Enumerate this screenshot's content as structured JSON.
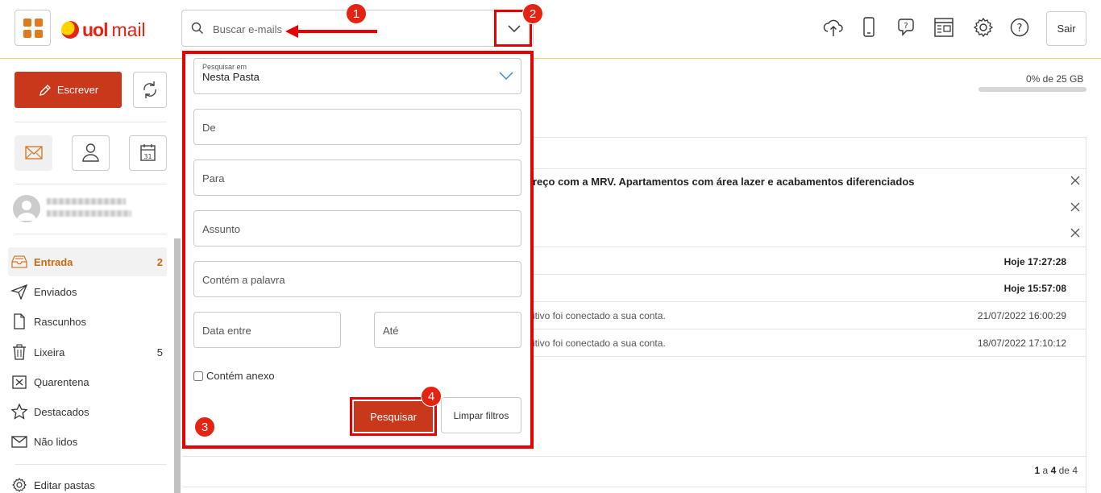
{
  "header": {
    "brand_uol": "uol",
    "brand_mail": "mail",
    "search_placeholder": "Buscar e-mails",
    "logout_label": "Sair",
    "icons": [
      "cloud-upload-icon",
      "mobile-icon",
      "help-chat-icon",
      "layout-icon",
      "gear-icon",
      "help-icon"
    ]
  },
  "annotations": {
    "badge_1": "1",
    "badge_2": "2",
    "badge_3": "3",
    "badge_4": "4",
    "color": "#e60000"
  },
  "sidebar": {
    "compose_label": "Escrever",
    "folders": [
      {
        "label": "Entrada",
        "count": "2",
        "icon": "inbox-icon"
      },
      {
        "label": "Enviados",
        "count": "",
        "icon": "send-icon"
      },
      {
        "label": "Rascunhos",
        "count": "",
        "icon": "draft-icon"
      },
      {
        "label": "Lixeira",
        "count": "5",
        "icon": "trash-icon"
      },
      {
        "label": "Quarentena",
        "count": "",
        "icon": "quarantine-icon"
      },
      {
        "label": "Destacados",
        "count": "",
        "icon": "star-icon"
      },
      {
        "label": "Não lidos",
        "count": "",
        "icon": "envelope-icon"
      },
      {
        "label": "Editar pastas",
        "count": "",
        "icon": "gear-icon"
      }
    ]
  },
  "storage": {
    "label": "0% de 25 GB",
    "used_fraction": 0.0
  },
  "messages": [
    {
      "text": "reço com a MRV. Apartamentos com área lazer e acabamentos diferenciados",
      "date": "",
      "bold": true
    },
    {
      "text": "",
      "date": "Hoje 17:27:28",
      "bold": true
    },
    {
      "text": "",
      "date": "Hoje 15:57:08",
      "bold": true
    },
    {
      "text": "itivo foi conectado a sua conta.",
      "date": "21/07/2022 16:00:29",
      "bold": false
    },
    {
      "text": "itivo foi conectado a sua conta.",
      "date": "18/07/2022 17:10:12",
      "bold": false
    }
  ],
  "pager": {
    "from": "1",
    "sep1": "a",
    "to": "4",
    "sep2": "de",
    "total": "4"
  },
  "advanced_search": {
    "search_in_label": "Pesquisar em",
    "search_in_value": "Nesta Pasta",
    "from_placeholder": "De",
    "to_placeholder": "Para",
    "subject_placeholder": "Assunto",
    "contains_placeholder": "Contém a palavra",
    "date_from_placeholder": "Data entre",
    "date_to_placeholder": "Até",
    "attachment_label": "Contém anexo",
    "search_button": "Pesquisar",
    "clear_button": "Limpar filtros"
  },
  "colors": {
    "accent": "#c9381a",
    "brand": "#e42313",
    "active_folder": "#c86a14"
  }
}
